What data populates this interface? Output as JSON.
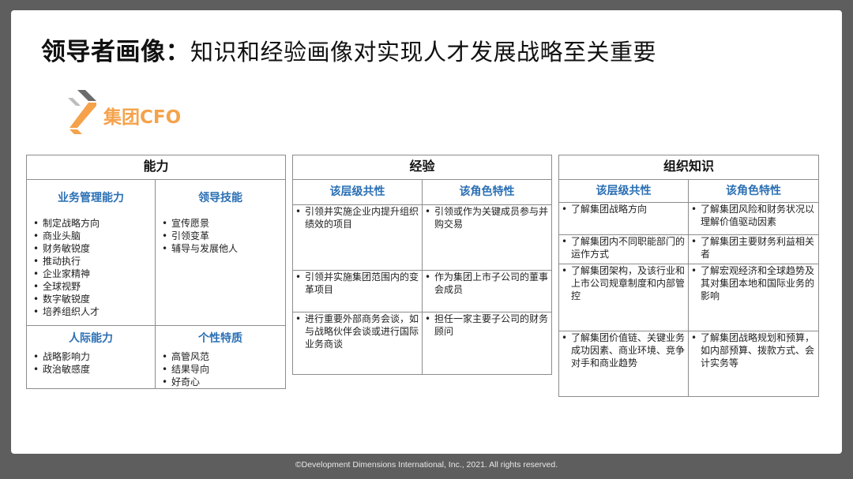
{
  "slide": {
    "title_bold": "领导者画像：",
    "title_rest": "知识和经验画像对实现人才发展战略至关重要",
    "brand": "集团CFO",
    "logo_icon": "chevron-logo-icon",
    "footer": "©Development Dimensions International, Inc., 2021. All rights reserved."
  },
  "colors": {
    "subheader": "#2a6fb4",
    "brand": "#f5a24b",
    "logo_gray": "#6b6b6b"
  },
  "ability": {
    "header": "能力",
    "biz_title": "业务管理能力",
    "biz_items": [
      "制定战略方向",
      "商业头脑",
      "财务敏锐度",
      "推动执行",
      "企业家精神",
      "全球视野",
      "数字敏锐度",
      "培养组织人才"
    ],
    "lead_title": "领导技能",
    "lead_items": [
      "宣传愿景",
      "引领变革",
      "辅导与发展他人"
    ],
    "people_title": "人际能力",
    "people_items": [
      "战略影响力",
      "政治敏感度"
    ],
    "trait_title": "个性特质",
    "trait_items": [
      "高管风范",
      "结果导向",
      "好奇心"
    ]
  },
  "experience": {
    "header": "经验",
    "col1": "该层级共性",
    "col2": "该角色特性",
    "rows": [
      [
        "引领并实施企业内提升组织绩效的项目",
        "引领或作为关键成员参与并购交易"
      ],
      [
        "引领并实施集团范围内的变革项目",
        "作为集团上市子公司的董事会成员"
      ],
      [
        "进行重要外部商务会谈，如与战略伙伴会谈或进行国际业务商谈",
        "担任一家主要子公司的财务顾问"
      ]
    ]
  },
  "knowledge": {
    "header": "组织知识",
    "col1": "该层级共性",
    "col2": "该角色特性",
    "rows": [
      [
        "了解集团战略方向",
        "了解集团风险和财务状况以理解价值驱动因素"
      ],
      [
        "了解集团内不同职能部门的运作方式",
        "了解集团主要财务利益相关者"
      ],
      [
        "了解集团架构，及该行业和上市公司规章制度和内部管控",
        "了解宏观经济和全球趋势及其对集团本地和国际业务的影响"
      ],
      [
        "了解集团价值链、关键业务成功因素、商业环境、竞争对手和商业趋势",
        "了解集团战略规划和预算，如内部预算、拨款方式、会计实务等"
      ]
    ]
  }
}
